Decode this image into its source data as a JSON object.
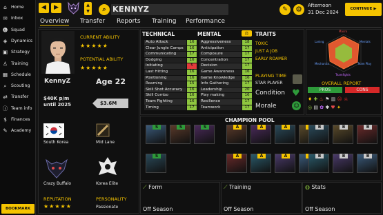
{
  "sidebar": {
    "items": [
      {
        "label": "Home",
        "icon": "home-icon",
        "glyph": "⌂"
      },
      {
        "label": "Inbox",
        "icon": "inbox-icon",
        "glyph": "✉"
      },
      {
        "label": "Squad",
        "icon": "squad-icon",
        "glyph": "☻"
      },
      {
        "label": "Dynamics",
        "icon": "dynamics-icon",
        "glyph": "◈"
      },
      {
        "label": "Strategy",
        "icon": "strategy-icon",
        "glyph": "▣"
      },
      {
        "label": "Training",
        "icon": "training-icon",
        "glyph": "♙"
      },
      {
        "label": "Schedule",
        "icon": "schedule-icon",
        "glyph": "▦"
      },
      {
        "label": "Scouting",
        "icon": "scouting-icon",
        "glyph": "⌕"
      },
      {
        "label": "Transfer",
        "icon": "transfer-icon",
        "glyph": "⇄"
      },
      {
        "label": "Team info",
        "icon": "team-info-icon",
        "glyph": "ⓘ"
      },
      {
        "label": "Finances",
        "icon": "finances-icon",
        "glyph": "$"
      },
      {
        "label": "Academy",
        "icon": "academy-icon",
        "glyph": "✎"
      }
    ],
    "bookmark": "BOOKMARK"
  },
  "topbar": {
    "player_name": "KENNYZ",
    "date_line1": "Afternoon",
    "date_line2": "31 Dec 2024",
    "continue_label": "CONTINUE"
  },
  "tabs": [
    "Overview",
    "Transfer",
    "Reports",
    "Training",
    "Performance"
  ],
  "profile": {
    "current_ability_label": "CURRENT ABILITY",
    "current_ability_stars": 5,
    "potential_ability_label": "POTENTIAL ABILITY",
    "potential_ability_stars": 5,
    "name": "KennyZ",
    "age": "Age 22",
    "wage_line1": "$40K p/m",
    "wage_line2": "until 2025",
    "value": "$3.6M",
    "country": "South Korea",
    "role": "Mid Lane",
    "personality_1": "Crazy Buffalo",
    "personality_2": "Korea Elite",
    "reputation_label": "REPUTATION",
    "reputation_stars": 5,
    "personality_label": "PERSONALITY",
    "personality_value": "Passionate"
  },
  "technical": {
    "header": "TECHNICAL",
    "attrs": [
      {
        "name": "Auto Attack",
        "value": "16",
        "color": "#8ec63f"
      },
      {
        "name": "Clear Jungle Camps",
        "value": "16",
        "color": "#8ec63f"
      },
      {
        "name": "Communicating",
        "value": "17",
        "color": "#8ec63f"
      },
      {
        "name": "Dodging",
        "value": "16",
        "color": "#8ec63f"
      },
      {
        "name": "Initiating",
        "value": "5",
        "color": "#e23b3b"
      },
      {
        "name": "Last Hitting",
        "value": "16",
        "color": "#8ec63f"
      },
      {
        "name": "Positioning",
        "value": "16",
        "color": "#8ec63f"
      },
      {
        "name": "Roaming",
        "value": "15",
        "color": "#8ec63f"
      },
      {
        "name": "Skill Shot Accuracy",
        "value": "16",
        "color": "#8ec63f"
      },
      {
        "name": "Skill Combo",
        "value": "16",
        "color": "#8ec63f"
      },
      {
        "name": "Team Fighting",
        "value": "16",
        "color": "#8ec63f"
      },
      {
        "name": "Timing",
        "value": "17",
        "color": "#8ec63f"
      }
    ]
  },
  "mental": {
    "header": "MENTAL",
    "attrs": [
      {
        "name": "Aggressiveness",
        "value": "18",
        "color": "#8ec63f"
      },
      {
        "name": "Anticipation",
        "value": "17",
        "color": "#8ec63f"
      },
      {
        "name": "Composure",
        "value": "17",
        "color": "#8ec63f"
      },
      {
        "name": "Concentration",
        "value": "17",
        "color": "#8ec63f"
      },
      {
        "name": "Decision",
        "value": "17",
        "color": "#8ec63f"
      },
      {
        "name": "Game Awareness",
        "value": "16",
        "color": "#8ec63f"
      },
      {
        "name": "Game Knowledge",
        "value": "16",
        "color": "#8ec63f"
      },
      {
        "name": "Info Gathering",
        "value": "17",
        "color": "#8ec63f"
      },
      {
        "name": "Leadership",
        "value": "20",
        "color": "#8ec63f"
      },
      {
        "name": "Play making",
        "value": "16",
        "color": "#8ec63f"
      },
      {
        "name": "Resilience",
        "value": "17",
        "color": "#8ec63f"
      },
      {
        "name": "Teamwork",
        "value": "17",
        "color": "#8ec63f"
      }
    ]
  },
  "traits": {
    "header": "TRAITS",
    "items": [
      "TOXIC",
      "JUST A JOB",
      "EARLY ROAMER"
    ],
    "playing_time_label": "PLAYING TIME",
    "playing_time_value": "STAR PLAYER",
    "condition_label": "Condition",
    "morale_label": "Morale"
  },
  "radar": {
    "labels": [
      "Macro",
      "Mentals",
      "Team Play",
      "Teamfights",
      "Mechanics",
      "Laning"
    ]
  },
  "overall_report": {
    "header": "OVERALL REPORT",
    "pros_label": "PROS",
    "cons_label": "CONS"
  },
  "champion_pool": {
    "header": "CHAMPION POOL",
    "left": [
      "S",
      "S",
      "S",
      "S"
    ],
    "center": [
      "A",
      "A",
      "A",
      "A",
      "A",
      "A",
      "A",
      "A"
    ],
    "right": [
      "B",
      "B",
      "B",
      "B",
      "B",
      "B",
      "B",
      "B"
    ]
  },
  "bottom": {
    "form_label": "Form",
    "training_label": "Training",
    "stats_label": "Stats",
    "off_season": "Off Season"
  },
  "colors": {
    "accent": "#f5c400",
    "good": "#8ec63f",
    "bad": "#e23b3b",
    "pros": "#2e9a3a",
    "cons": "#d62828"
  }
}
